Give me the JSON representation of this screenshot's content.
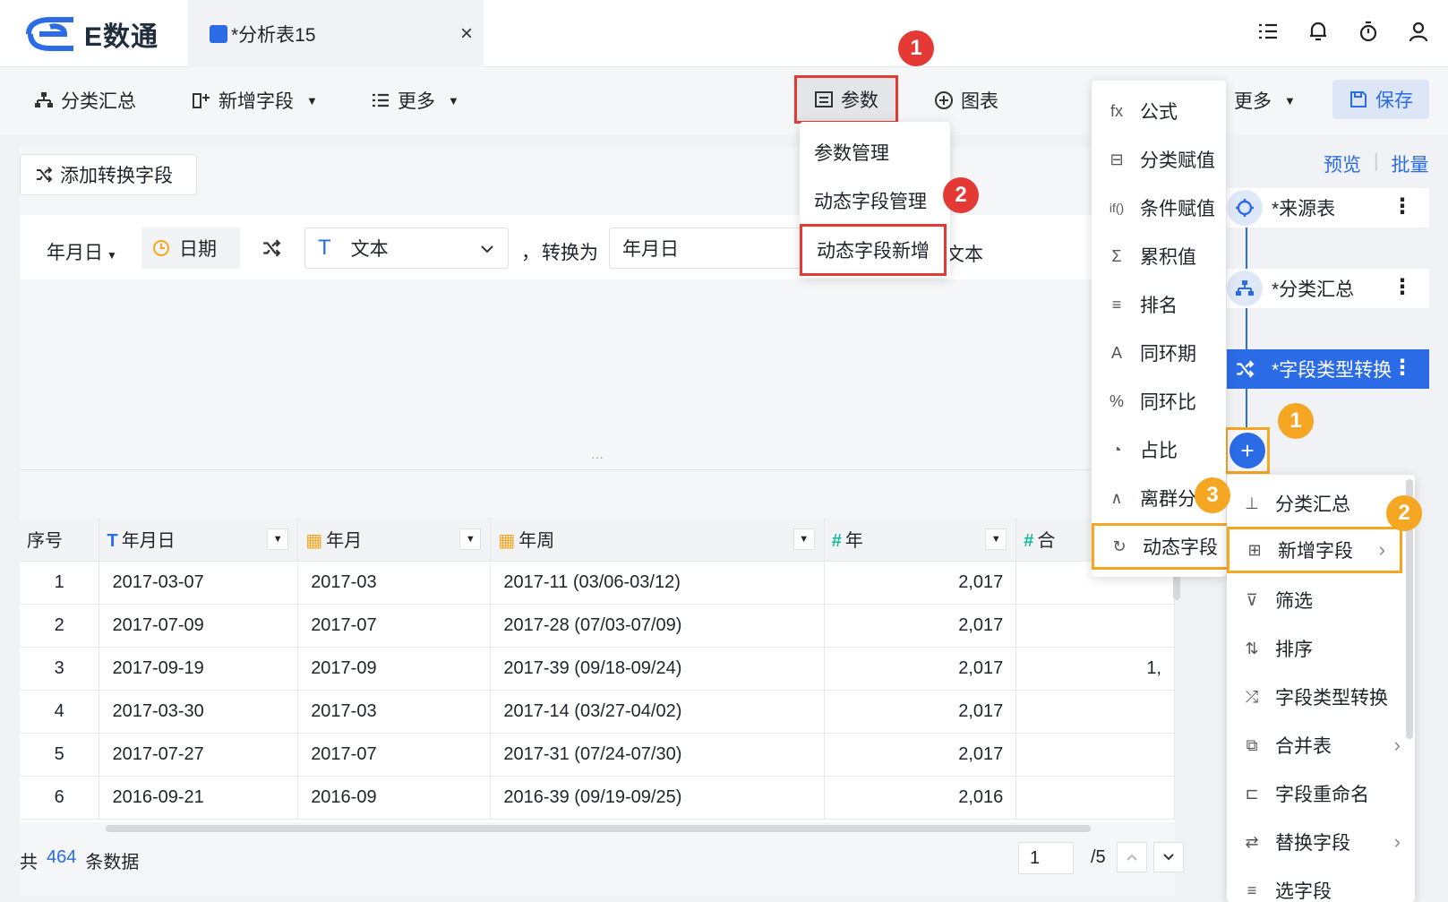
{
  "app": {
    "brand": "E数通"
  },
  "tab": {
    "title": "*分析表15",
    "close": "×"
  },
  "toolbar": {
    "group_summary": "分类汇总",
    "add_field": "新增字段",
    "more_left": "更多",
    "params": "参数",
    "chart": "图表",
    "more_right": "更多",
    "save": "保存"
  },
  "params_menu": {
    "items": [
      "参数管理",
      "动态字段管理",
      "动态字段新增"
    ]
  },
  "formula_menu": {
    "items": [
      {
        "icon": "fx",
        "label": "公式"
      },
      {
        "icon": "⊟",
        "label": "分类赋值"
      },
      {
        "icon": "if()",
        "label": "条件赋值"
      },
      {
        "icon": "Σ",
        "label": "累积值"
      },
      {
        "icon": "≡",
        "label": "排名"
      },
      {
        "icon": "A",
        "label": "同环期"
      },
      {
        "icon": "%",
        "label": "同环比"
      },
      {
        "icon": "◔",
        "label": "占比"
      },
      {
        "icon": "∧",
        "label": "离群分"
      },
      {
        "icon": "↻",
        "label": "动态字段"
      }
    ]
  },
  "transform": {
    "add_button": "添加转换字段",
    "field": "年月日",
    "from_type": "日期",
    "to_type_icon": "T",
    "to_type": "文本",
    "comma": "，",
    "convert_as": "转换为",
    "format": "年月日",
    "to_type_trailing": "文本"
  },
  "splitter_dots": "···",
  "table": {
    "columns": [
      {
        "label": "序号",
        "icon": ""
      },
      {
        "label": "年月日",
        "icon": "T"
      },
      {
        "label": "年月",
        "icon": "▦"
      },
      {
        "label": "年周",
        "icon": "▦"
      },
      {
        "label": "年",
        "icon": "#"
      },
      {
        "label": "合",
        "icon": "#"
      }
    ],
    "rows": [
      [
        "1",
        "2017-03-07",
        "2017-03",
        "2017-11 (03/06-03/12)",
        "2,017",
        ""
      ],
      [
        "2",
        "2017-07-09",
        "2017-07",
        "2017-28 (07/03-07/09)",
        "2,017",
        ""
      ],
      [
        "3",
        "2017-09-19",
        "2017-09",
        "2017-39 (09/18-09/24)",
        "2,017",
        "1,"
      ],
      [
        "4",
        "2017-03-30",
        "2017-03",
        "2017-14 (03/27-04/02)",
        "2,017",
        ""
      ],
      [
        "5",
        "2017-07-27",
        "2017-07",
        "2017-31 (07/24-07/30)",
        "2,017",
        ""
      ],
      [
        "6",
        "2016-09-21",
        "2016-09",
        "2016-39 (09/19-09/25)",
        "2,016",
        ""
      ]
    ]
  },
  "footer": {
    "prefix": "共",
    "count": "464",
    "suffix": "条数据",
    "page": "1",
    "total_pages": "/5"
  },
  "flow": {
    "preview": "预览",
    "batch": "批量",
    "nodes": [
      "*来源表",
      "*分类汇总",
      "*字段类型转换"
    ]
  },
  "step_menu": {
    "items": [
      {
        "label": "分类汇总",
        "arrow": false
      },
      {
        "label": "新增字段",
        "arrow": true
      },
      {
        "label": "筛选",
        "arrow": false
      },
      {
        "label": "排序",
        "arrow": false
      },
      {
        "label": "字段类型转换",
        "arrow": false
      },
      {
        "label": "合并表",
        "arrow": true
      },
      {
        "label": "字段重命名",
        "arrow": false
      },
      {
        "label": "替换字段",
        "arrow": true
      },
      {
        "label": "选字段",
        "arrow": false
      }
    ]
  },
  "badges": {
    "red1": "1",
    "red2": "2",
    "orange1": "1",
    "orange2": "2",
    "orange3": "3"
  },
  "colors": {
    "accent": "#2b6be6",
    "highlight_red": "#e53935",
    "highlight_orange": "#f5a623"
  }
}
